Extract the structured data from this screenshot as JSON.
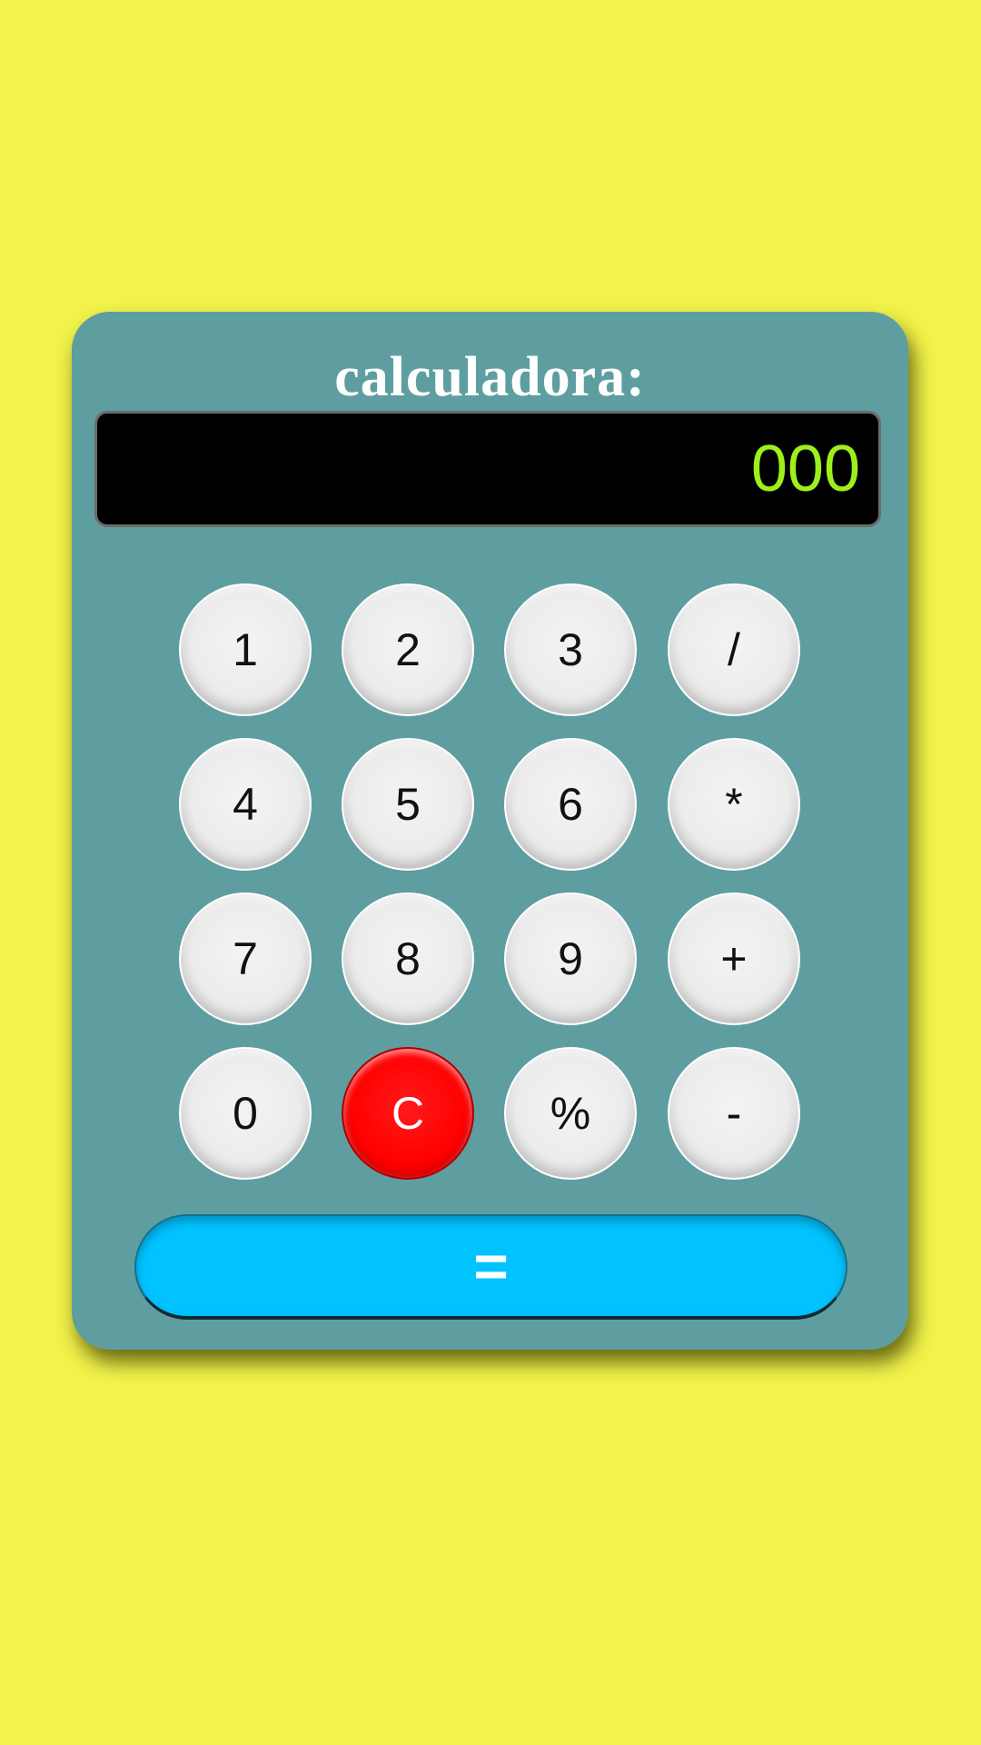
{
  "page": {
    "background_color": "#f2f24b"
  },
  "calculator": {
    "title": "calculadora:",
    "display_value": "000",
    "body_color": "#5f9ea0",
    "display_text_color": "#9ef01a",
    "keys": {
      "k1": "1",
      "k2": "2",
      "k3": "3",
      "divide": "/",
      "k4": "4",
      "k5": "5",
      "k6": "6",
      "multiply": "*",
      "k7": "7",
      "k8": "8",
      "k9": "9",
      "plus": "+",
      "k0": "0",
      "clear": "C",
      "percent": "%",
      "minus": "-"
    },
    "equals_label": "=",
    "clear_color": "#ff0000",
    "equals_color": "#00c3ff"
  }
}
